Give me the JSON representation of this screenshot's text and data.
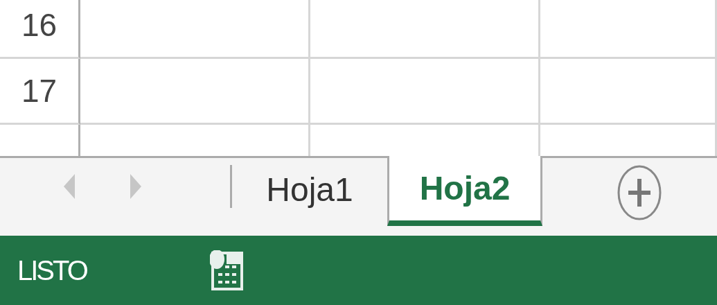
{
  "grid": {
    "row_headers": [
      "16",
      "17"
    ]
  },
  "sheet_tabs": [
    {
      "label": "Hoja1",
      "selected": false
    },
    {
      "label": "Hoja2",
      "selected": true
    }
  ],
  "status_bar": {
    "text": "LISTO"
  }
}
